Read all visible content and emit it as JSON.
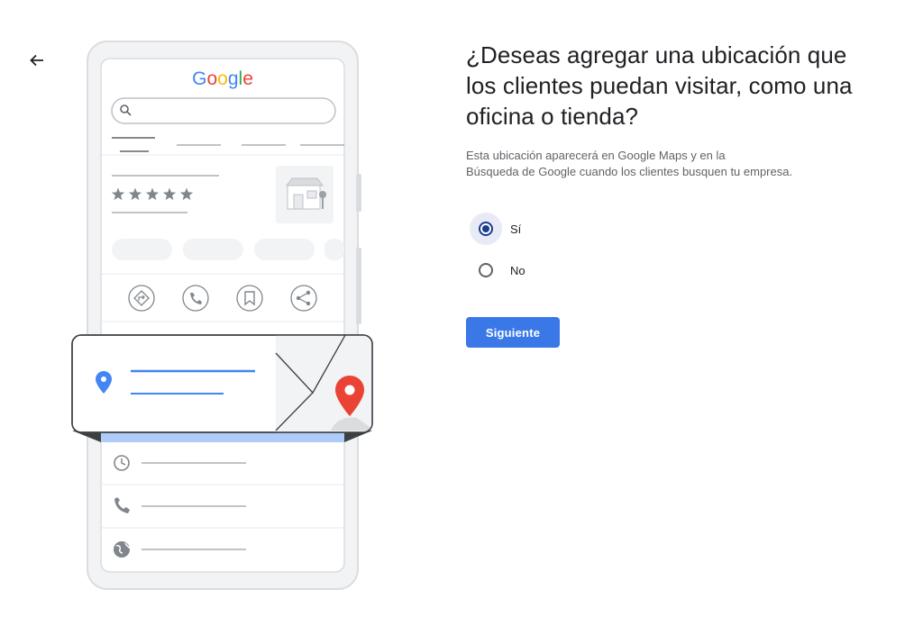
{
  "nav": {
    "back_icon": "arrow-left-icon"
  },
  "illustration": {
    "logo_text": "Google",
    "logo_colors": [
      "#4285F4",
      "#EA4335",
      "#FBBC05",
      "#4285F4",
      "#34A853",
      "#EA4335"
    ],
    "rating_stars": 5,
    "action_icons": [
      "directions-icon",
      "phone-icon",
      "bookmark-icon",
      "share-icon"
    ],
    "detail_icons": [
      "clock-icon",
      "phone-icon",
      "globe-icon"
    ],
    "pin_colors": {
      "blue": "#4285F4",
      "red": "#EA4335"
    }
  },
  "question": {
    "title": "¿Deseas agregar una ubicación que los clientes puedan visitar, como una oficina o tienda?",
    "description": "Esta ubicación aparecerá en Google Maps y en la\nBúsqueda de Google cuando los clientes busquen tu empresa."
  },
  "options": [
    {
      "label": "Sí",
      "selected": true
    },
    {
      "label": "No",
      "selected": false
    }
  ],
  "next_button": {
    "label": "Siguiente"
  },
  "colors": {
    "primary": "#3b78e7",
    "radio_selected": "#1a3c8f"
  }
}
